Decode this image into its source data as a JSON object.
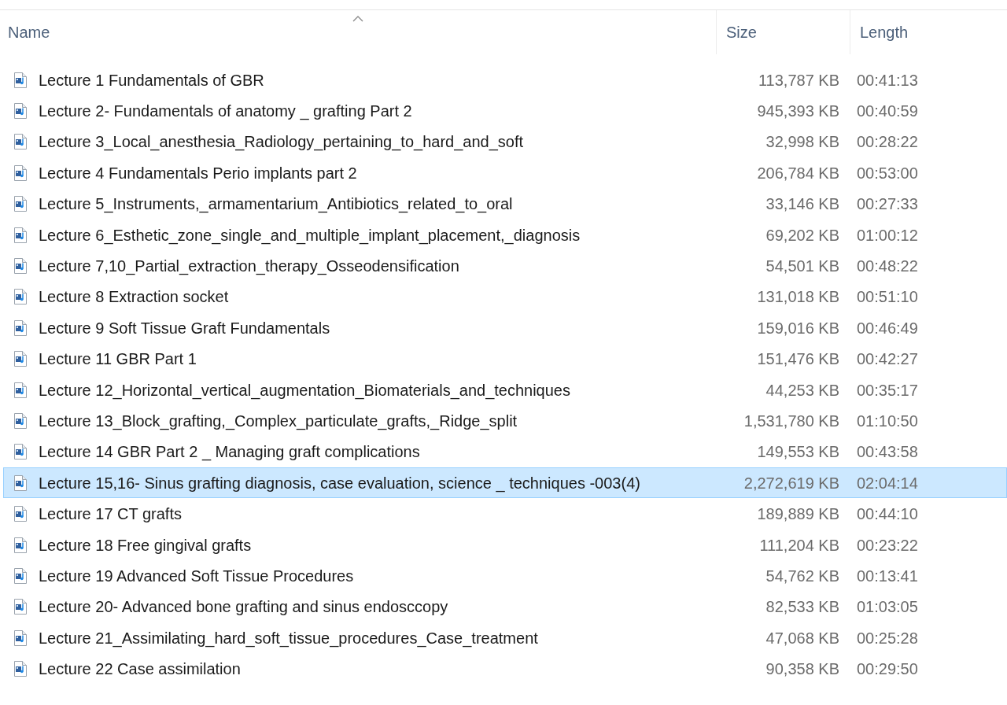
{
  "columns": [
    "Name",
    "Size",
    "Length"
  ],
  "rows": [
    {
      "name": "Lecture 1 Fundamentals of GBR",
      "size": "113,787 KB",
      "length": "00:41:13",
      "selected": false
    },
    {
      "name": "Lecture 2- Fundamentals of anatomy _ grafting Part 2",
      "size": "945,393 KB",
      "length": "00:40:59",
      "selected": false
    },
    {
      "name": "Lecture 3_Local_anesthesia_Radiology_pertaining_to_hard_and_soft",
      "size": "32,998 KB",
      "length": "00:28:22",
      "selected": false
    },
    {
      "name": "Lecture 4 Fundamentals Perio implants part 2",
      "size": "206,784 KB",
      "length": "00:53:00",
      "selected": false
    },
    {
      "name": "Lecture 5_Instruments,_armamentarium_Antibiotics_related_to_oral",
      "size": "33,146 KB",
      "length": "00:27:33",
      "selected": false
    },
    {
      "name": "Lecture 6_Esthetic_zone_single_and_multiple_implant_placement,_diagnosis",
      "size": "69,202 KB",
      "length": "01:00:12",
      "selected": false
    },
    {
      "name": "Lecture 7,10_Partial_extraction_therapy_Osseodensification",
      "size": "54,501 KB",
      "length": "00:48:22",
      "selected": false
    },
    {
      "name": "Lecture 8 Extraction socket",
      "size": "131,018 KB",
      "length": "00:51:10",
      "selected": false
    },
    {
      "name": "Lecture 9 Soft Tissue Graft Fundamentals",
      "size": "159,016 KB",
      "length": "00:46:49",
      "selected": false
    },
    {
      "name": "Lecture 11 GBR Part 1",
      "size": "151,476 KB",
      "length": "00:42:27",
      "selected": false
    },
    {
      "name": "Lecture 12_Horizontal_vertical_augmentation_Biomaterials_and_techniques",
      "size": "44,253 KB",
      "length": "00:35:17",
      "selected": false
    },
    {
      "name": "Lecture 13_Block_grafting,_Complex_particulate_grafts,_Ridge_split",
      "size": "1,531,780 KB",
      "length": "01:10:50",
      "selected": false
    },
    {
      "name": "Lecture 14 GBR Part 2 _ Managing graft complications",
      "size": "149,553 KB",
      "length": "00:43:58",
      "selected": false
    },
    {
      "name": "Lecture 15,16- Sinus grafting diagnosis, case evaluation, science _ techniques -003(4)",
      "size": "2,272,619 KB",
      "length": "02:04:14",
      "selected": true
    },
    {
      "name": "Lecture 17 CT grafts",
      "size": "189,889 KB",
      "length": "00:44:10",
      "selected": false
    },
    {
      "name": "Lecture 18 Free gingival grafts",
      "size": "111,204 KB",
      "length": "00:23:22",
      "selected": false
    },
    {
      "name": "Lecture 19 Advanced Soft Tissue Procedures",
      "size": "54,762 KB",
      "length": "00:13:41",
      "selected": false
    },
    {
      "name": "Lecture 20- Advanced bone grafting and sinus endosccopy",
      "size": "82,533 KB",
      "length": "01:03:05",
      "selected": false
    },
    {
      "name": "Lecture 21_Assimilating_hard_soft_tissue_procedures_Case_treatment",
      "size": "47,068 KB",
      "length": "00:25:28",
      "selected": false
    },
    {
      "name": "Lecture 22 Case assimilation",
      "size": "90,358 KB",
      "length": "00:29:50",
      "selected": false
    }
  ]
}
